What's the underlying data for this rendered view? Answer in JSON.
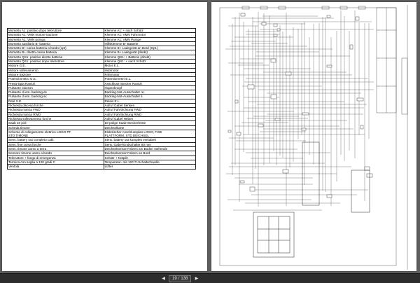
{
  "legend": [
    [
      "Morsetto A1: positivo dopo teleruttore",
      "Klemme A1: + nach Schütz"
    ],
    [
      "Morsetto A1: VMN motore trazione",
      "Klemme A1: VMN Fahrmotor"
    ],
    [
      "Morsetto A1: VMN pompa",
      "Klemme A1: VMN Pumpe"
    ],
    [
      "Morsetto ausiliario B- batteria",
      "Hilfsklemme B- Batterie"
    ],
    [
      "Morsetto B+ carica batteria a bordo (opt)",
      "Klemme B+ Ladegerät an Bord (Opt.)"
    ],
    [
      "Morsetto B+ diretto carica batteria",
      "Klemme B+ Ladegerät (direkt)"
    ],
    [
      "Morsetto QS1: positivo diretto batteria",
      "Klemme QS1: + Batterie (direkt)"
    ],
    [
      "Morsetto QS1: positivo dopo teleruttore",
      "Klemme QS1: + nach Schütz"
    ],
    [
      "Motore G.E.",
      "Motor E.L."
    ],
    [
      "Motore sollevamento",
      "Hubmotor"
    ],
    [
      "Motore trazione",
      "Fahrmotor"
    ],
    [
      "Potenziometro G.E.",
      "Potentiometer E.L."
    ],
    [
      "Presa-Spia Ravioli",
      "Anschluss-Stecker Ravioli"
    ],
    [
      "Pulsante clacson",
      "Hupenknopf"
    ],
    [
      "Pulsante di em. backing dx",
      "Backing-Not-Ausschalter re."
    ],
    [
      "Pulsante di em. backing sx",
      "Backing-Not-Ausschalter li."
    ],
    [
      "Relè S.E.",
      "Relais E.L."
    ],
    [
      "Richiesta discesa forche",
      "Aufruf Gabel Senken"
    ],
    [
      "Richiesta marcia FWD",
      "Aufruf Fahrtrichtung FWD"
    ],
    [
      "Richiesta marcia RWD",
      "Aufruf Fahrtrichtung RWD"
    ],
    [
      "Richiesta sollevamento forche",
      "Aufruf Gabel Heben"
    ],
    [
      "Saab 10 poli",
      "10-polige Saab-Steckerleiste"
    ],
    [
      "Scheda timone",
      "Deichselkarte"
    ],
    [
      "Schema di collegamento elettrico LOGO PF\nSTD TIMONE",
      "Elektrischer Anschlussplan LOGO, FIXE\nPLATTFORM, STD DEICHSEL"
    ],
    [
      "Sens. battery out completo cabl.",
      "Sens. battery out komplett verkabelt"
    ],
    [
      "Sens. fine corsa forche",
      "Sens. Gabel-Endschalter 80 mm"
    ],
    [
      "Sens. timone uomo a terra",
      "Deichselsensor Fahren am Boden stehende"
    ],
    [
      "Sensore timone uomo a bordo",
      "Deichselsensor Fahren an Bord"
    ],
    [
      "Teleruttore + fungo di emergenza",
      "Schütz + Notpilz"
    ],
    [
      "Termica con soglia a 120 gradi C",
      "Temperatur- mit 120°C-Schaltschwelle"
    ],
    [
      "Ventola",
      "Lüfter"
    ]
  ],
  "toolbar": {
    "prev_icon": "◀",
    "next_icon": "▶",
    "current_page": "19",
    "separator": "/",
    "total_pages": "138"
  }
}
